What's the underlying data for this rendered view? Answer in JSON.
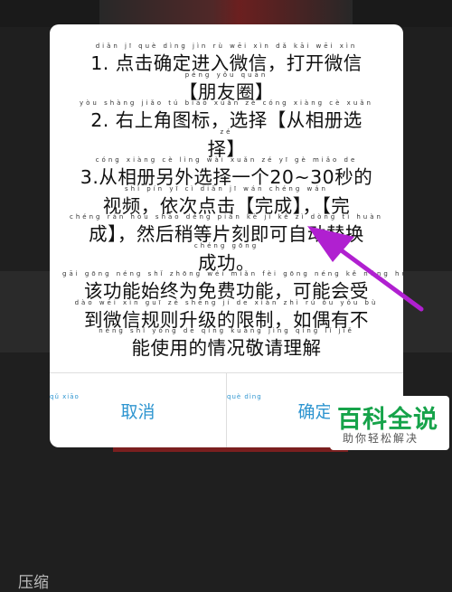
{
  "background": {
    "side_label": "压缩"
  },
  "dialog": {
    "lines": [
      {
        "pinyin": "diǎn jī què dìng jìn rù wēi xìn dǎ kāi wēi xìn",
        "text": "1. 点击确定进入微信，打开微信"
      },
      {
        "pinyin": "péng yǒu quān",
        "text": "【朋友圈】"
      },
      {
        "pinyin": "yòu shàng jiǎo tú biāo xuǎn zé cóng xiàng cè xuǎn",
        "text": "2. 右上角图标，选择【从相册选"
      },
      {
        "pinyin": "zé",
        "text": "择】"
      },
      {
        "pinyin": "cóng xiàng cè lìng wài xuǎn zé yī gè miǎo de",
        "text": "3.从相册另外选择一个20~30秒的"
      },
      {
        "pinyin": "shì pín yī cì diǎn jī wán chéng wán",
        "text": "视频，依次点击【完成】，【完"
      },
      {
        "pinyin": "chéng rán hòu shāo děng piàn kè jí kě zì dòng tì huàn",
        "text": "成】，然后稍等片刻即可自动替换"
      },
      {
        "pinyin": "chéng gōng",
        "text": "成功。"
      },
      {
        "pinyin": "gāi gōng néng shǐ zhōng wéi miǎn fèi gōng néng kě néng huì shòu",
        "text": "该功能始终为免费功能，可能会受"
      },
      {
        "pinyin": "dào wēi xìn guī zé shēng jí de xiàn zhì rú ǒu yǒu bù",
        "text": "到微信规则升级的限制，如偶有不"
      },
      {
        "pinyin": "néng shǐ yòng de qíng kuàng jìng qǐng lǐ jiě",
        "text": "能使用的情况敬请理解"
      }
    ],
    "cancel": {
      "pinyin": "qǔ xiāo",
      "label": "取消"
    },
    "confirm": {
      "pinyin": "què dìng",
      "label": "确定"
    }
  },
  "watermark": {
    "title": "百科全说",
    "subtitle": "助你轻松解决"
  },
  "colors": {
    "accent": "#2e95d0",
    "arrow": "#b020d0",
    "watermark_green": "#16a34a"
  }
}
